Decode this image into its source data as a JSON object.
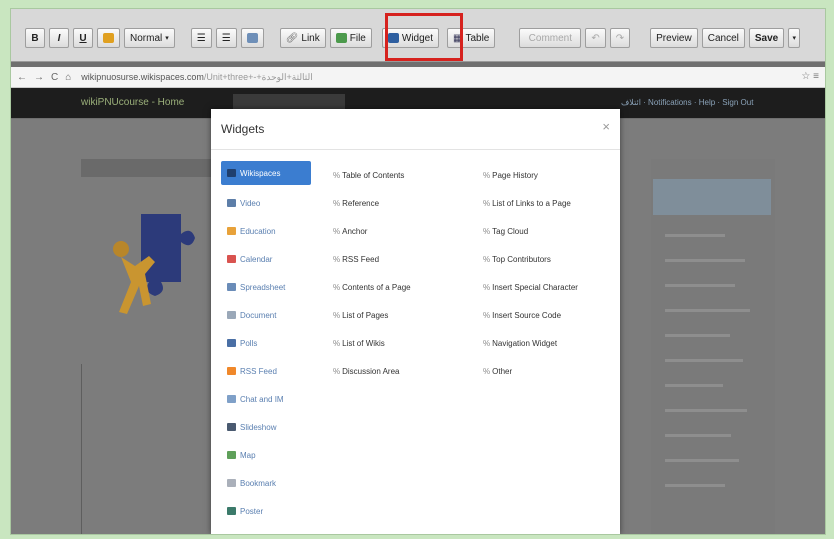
{
  "toolbar": {
    "bold": "B",
    "italic": "I",
    "underline": "U",
    "style_select": "Normal",
    "link": "Link",
    "file": "File",
    "widget": "Widget",
    "table": "Table",
    "comment": "Comment",
    "preview": "Preview",
    "cancel": "Cancel",
    "save": "Save"
  },
  "browser": {
    "url_host": "wikipnuosurse.wikispaces.com",
    "url_path": "/Unit+three+-+الثالثة+الوحدة"
  },
  "site": {
    "title": "wikiPNUcourse - Home",
    "links": "ائتلاف · Notifications · Help · Sign Out"
  },
  "modal": {
    "title": "Widgets",
    "close": "×",
    "categories": [
      {
        "label": "Wikispaces",
        "icon": "wikispaces-icon",
        "color": "#2a4f85"
      },
      {
        "label": "Video",
        "icon": "video-icon",
        "color": "#5d7ea8"
      },
      {
        "label": "Education",
        "icon": "education-icon",
        "color": "#e8a23a"
      },
      {
        "label": "Calendar",
        "icon": "calendar-icon",
        "color": "#d9534f"
      },
      {
        "label": "Spreadsheet",
        "icon": "spreadsheet-icon",
        "color": "#6a8cb8"
      },
      {
        "label": "Document",
        "icon": "document-icon",
        "color": "#9aa8b8"
      },
      {
        "label": "Polls",
        "icon": "polls-icon",
        "color": "#4a6fa5"
      },
      {
        "label": "RSS Feed",
        "icon": "rss-icon",
        "color": "#f0882a"
      },
      {
        "label": "Chat and IM",
        "icon": "chat-icon",
        "color": "#7fa0c8"
      },
      {
        "label": "Slideshow",
        "icon": "slideshow-icon",
        "color": "#4a5a70"
      },
      {
        "label": "Map",
        "icon": "map-icon",
        "color": "#5fa05a"
      },
      {
        "label": "Bookmark",
        "icon": "bookmark-icon",
        "color": "#aab0ba"
      },
      {
        "label": "Poster",
        "icon": "poster-icon",
        "color": "#3b7a6a"
      }
    ],
    "widgets_col1": [
      "Table of Contents",
      "Reference",
      "Anchor",
      "RSS Feed",
      "Contents of a Page",
      "List of Pages",
      "List of Wikis",
      "Discussion Area"
    ],
    "widgets_col2": [
      "Page History",
      "List of Links to a Page",
      "Tag Cloud",
      "Top Contributors",
      "Insert Special Character",
      "Insert Source Code",
      "Navigation Widget",
      "Other"
    ]
  }
}
